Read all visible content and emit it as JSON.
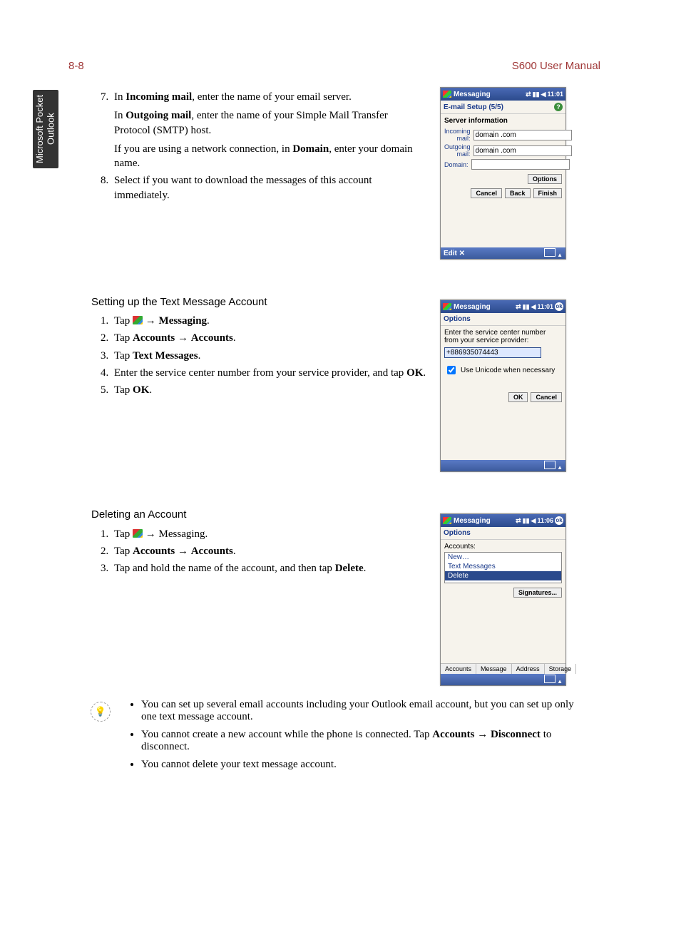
{
  "header": {
    "page_num": "8-8",
    "title": "S600 User Manual"
  },
  "sidebar_tab": "Microsoft Pocket Outlook",
  "steps_7_8": {
    "s7_a": "In ",
    "s7_b": "Incoming mail",
    "s7_c": ", enter the name of your email server.",
    "s7_d": "In ",
    "s7_e": "Outgoing mail",
    "s7_f": ", enter the name of your Simple Mail Transfer Protocol (SMTP) host.",
    "s7_g": "If you are using a network connection, in ",
    "s7_h": "Domain",
    "s7_i": ", enter your domain name.",
    "s8": "Select if you want to download the messages of this account immediately."
  },
  "heading_text_setup": "Setting up the Text Message Account",
  "text_setup_steps": {
    "s1a": "Tap ",
    "s1b": " → ",
    "s1c": "Messaging",
    "s1d": ".",
    "s2a": "Tap ",
    "s2b": "Accounts",
    "s2c": " → ",
    "s2d": "Accounts",
    "s2e": ".",
    "s3a": "Tap ",
    "s3b": "Text Messages",
    "s3c": ".",
    "s4a": "Enter the service center number from your service provider, and tap ",
    "s4b": "OK",
    "s4c": ".",
    "s5a": "Tap ",
    "s5b": "OK",
    "s5c": "."
  },
  "heading_delete": "Deleting an Account",
  "delete_steps": {
    "s1a": "Tap ",
    "s1b": " → Messaging.",
    "s2a": "Tap ",
    "s2b": "Accounts",
    "s2c": " → ",
    "s2d": "Accounts",
    "s2e": ".",
    "s3a": "Tap and hold the name of the account, and then tap ",
    "s3b": "Delete",
    "s3c": "."
  },
  "notes": {
    "n1a": "You can set up several email accounts including your Outlook email account, but you can set up only one text message account.",
    "n2a": "You cannot create a new account while the phone is connected. Tap ",
    "n2b": "Accounts",
    "n2c": " → ",
    "n2d": "Disconnect",
    "n2e": " to disconnect.",
    "n3": "You cannot delete your text message account."
  },
  "dev1": {
    "title": "Messaging",
    "time": "11:01",
    "subtitle": "E-mail Setup (5/5)",
    "server_info": "Server information",
    "lbl_incoming": "Incoming mail:",
    "val_incoming": "domain .com",
    "lbl_outgoing": "Outgoing mail:",
    "val_outgoing": "domain .com",
    "lbl_domain": "Domain:",
    "val_domain": "",
    "btn_options": "Options",
    "btn_cancel": "Cancel",
    "btn_back": "Back",
    "btn_finish": "Finish",
    "bottom_left": "Edit ✕",
    "help": "?"
  },
  "dev2": {
    "title": "Messaging",
    "time": "11:01",
    "subtitle": "Options",
    "instr": "Enter the service center number from your service provider:",
    "val_num": "+886935074443",
    "chk_label": "Use Unicode when necessary",
    "btn_ok": "OK",
    "btn_cancel": "Cancel",
    "ok_circle": "ok"
  },
  "dev3": {
    "title": "Messaging",
    "time": "11:06",
    "subtitle": "Options",
    "accounts_label": "Accounts:",
    "item_new": "New…",
    "item_text": "Text Messages",
    "item_delete": "Delete",
    "btn_sig": "Signatures...",
    "tab1": "Accounts",
    "tab2": "Message",
    "tab3": "Address",
    "tab4": "Storage",
    "ok_circle": "ok"
  }
}
